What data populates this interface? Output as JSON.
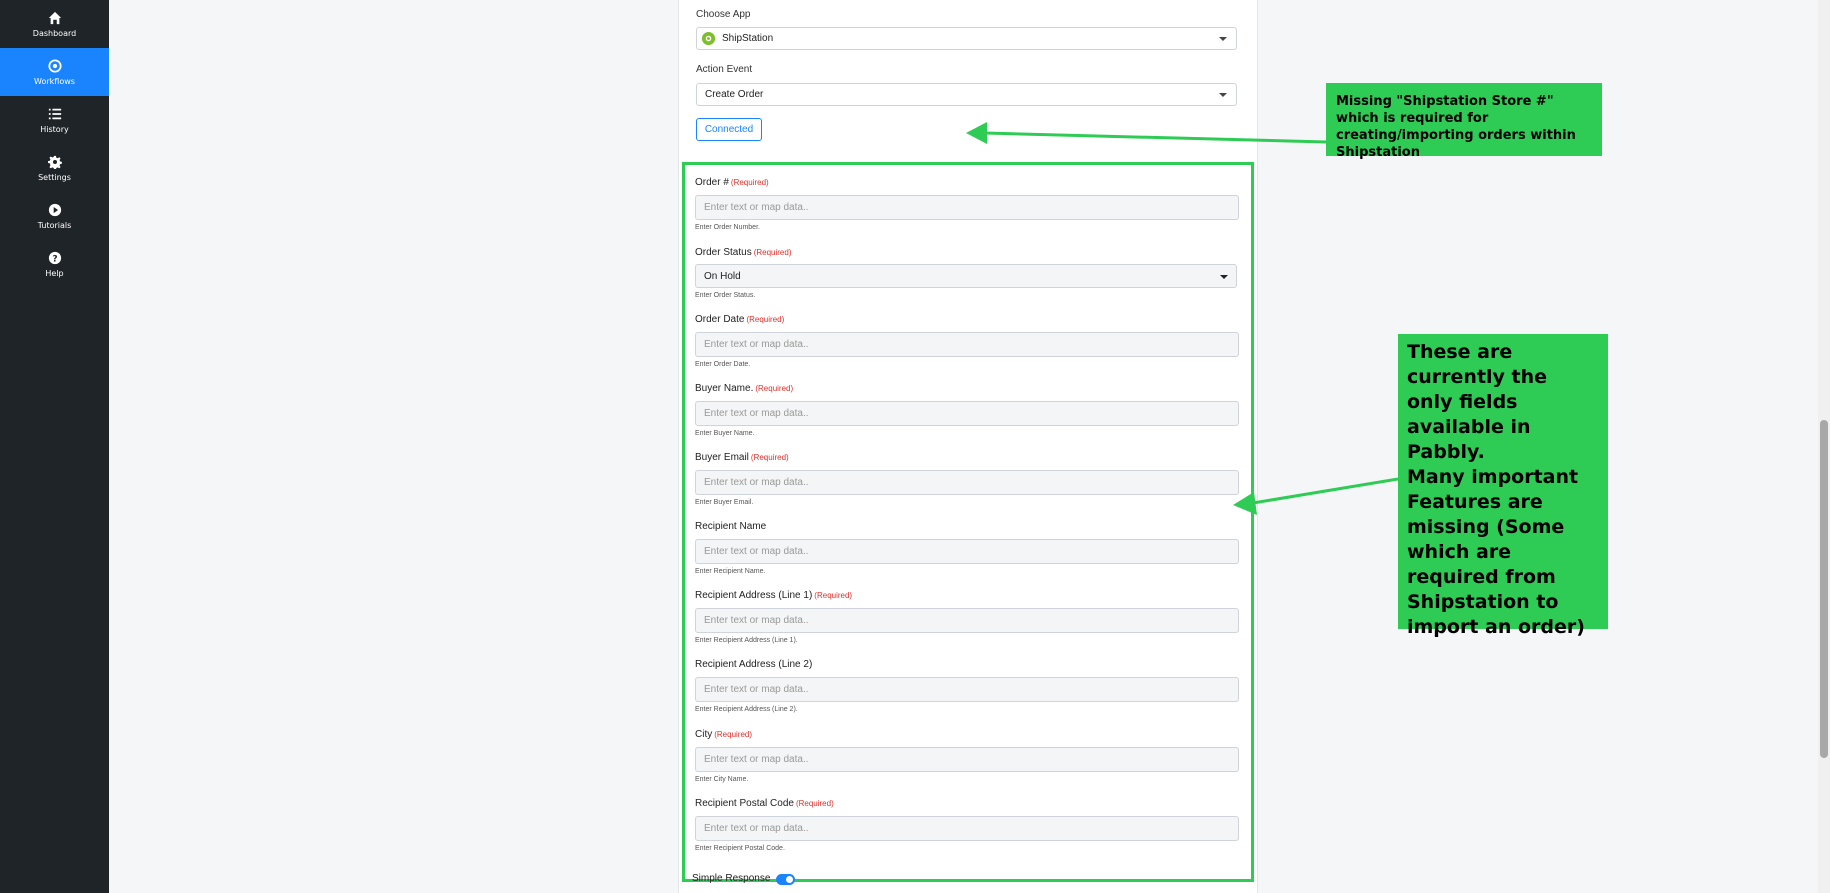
{
  "sidebar": {
    "items": [
      {
        "label": "Dashboard",
        "icon": "home-icon"
      },
      {
        "label": "Workflows",
        "icon": "workflow-icon"
      },
      {
        "label": "History",
        "icon": "list-icon"
      },
      {
        "label": "Settings",
        "icon": "gear-icon"
      },
      {
        "label": "Tutorials",
        "icon": "play-icon"
      },
      {
        "label": "Help",
        "icon": "help-icon"
      }
    ],
    "active": "Workflows"
  },
  "action": {
    "choose_app_label": "Choose App",
    "app_value": "ShipStation",
    "action_event_label": "Action Event",
    "action_event_value": "Create Order",
    "connected_label": "Connected"
  },
  "form": {
    "required_text": "(Required)",
    "placeholder": "Enter text or map data..",
    "fields": [
      {
        "label": "Order #",
        "help": "Enter Order Number."
      },
      {
        "label": "Order Status",
        "help": "Enter Order Status.",
        "value": "On Hold"
      },
      {
        "label": "Order Date",
        "help": "Enter Order Date."
      },
      {
        "label": "Buyer Name.",
        "help": "Enter Buyer Name."
      },
      {
        "label": "Buyer Email",
        "help": "Enter Buyer Email."
      },
      {
        "label": "Recipient Name",
        "help": "Enter Recipient Name."
      },
      {
        "label": "Recipient Address (Line 1)",
        "help": "Enter Recipient Address (Line 1)."
      },
      {
        "label": "Recipient Address (Line 2)",
        "help": "Enter Recipient Address (Line 2)."
      },
      {
        "label": "City",
        "help": "Enter City Name."
      },
      {
        "label": "Recipient Postal Code",
        "help": "Enter Recipient Postal Code."
      }
    ],
    "simple_response_label": "Simple Response"
  },
  "annotations": {
    "note1": "Missing \"Shipstation Store #\" which is required for creating/importing orders within Shipstation",
    "note2": "These are currently the only fields available in Pabbly.\nMany important Features are missing (Some which are required from Shipstation to import an order)"
  },
  "colors": {
    "sidebar_bg": "#1f2428",
    "accent": "#1a84ff",
    "annotation_green": "#2ecc55",
    "required_red": "#e0302a"
  }
}
